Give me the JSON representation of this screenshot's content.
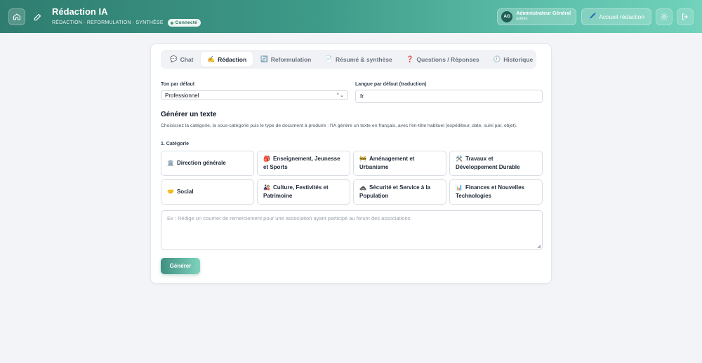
{
  "header": {
    "title": "Rédaction IA",
    "subtitle": "RÉDACTION · REFORMULATION · SYNTHÈSE",
    "status_badge": "Connecté",
    "user": {
      "initials": "AG",
      "name": "Administrateur Général",
      "role": "admin"
    },
    "home_button_label": "Accueil rédaction"
  },
  "tabs": [
    {
      "icon": "💬",
      "label": "Chat",
      "active": false
    },
    {
      "icon": "✍️",
      "label": "Rédaction",
      "active": true
    },
    {
      "icon": "🔄",
      "label": "Reformulation",
      "active": false
    },
    {
      "icon": "📄",
      "label": "Résumé & synthèse",
      "active": false
    },
    {
      "icon": "❓",
      "label": "Questions / Réponses",
      "active": false
    },
    {
      "icon": "🕘",
      "label": "Historique",
      "active": false
    }
  ],
  "form": {
    "tone_label": "Ton par défaut",
    "tone_value": "Professionnel",
    "lang_label": "Langue par défaut (traduction)",
    "lang_value": "fr",
    "section_title": "Générer un texte",
    "description": "Choisissez la catégorie, la sous-catégorie puis le type de document à produire : l'IA génère un texte en français, avec l'en-tête habituel (expéditeur, date, suivi par, objet).",
    "step_label": "1. Catégorie",
    "categories": [
      {
        "emoji": "🏛️",
        "label": "Direction générale"
      },
      {
        "emoji": "🎒",
        "label": "Enseignement, Jeunesse et Sports"
      },
      {
        "emoji": "🚧",
        "label": "Aménagement et Urbanisme"
      },
      {
        "emoji": "🛠️",
        "label": "Travaux et Développement Durable"
      },
      {
        "emoji": "🤝",
        "label": "Social"
      },
      {
        "emoji": "🎎",
        "label": "Culture, Festivités et Patrimoine"
      },
      {
        "emoji": "🚓",
        "label": "Sécurité et Service à la Population"
      },
      {
        "emoji": "📊",
        "label": "Finances et Nouvelles Technologies"
      }
    ],
    "prompt_placeholder": "Ex : Rédige un courrier de remerciement pour une association ayant participé au forum des associations.",
    "generate_label": "Générer"
  }
}
